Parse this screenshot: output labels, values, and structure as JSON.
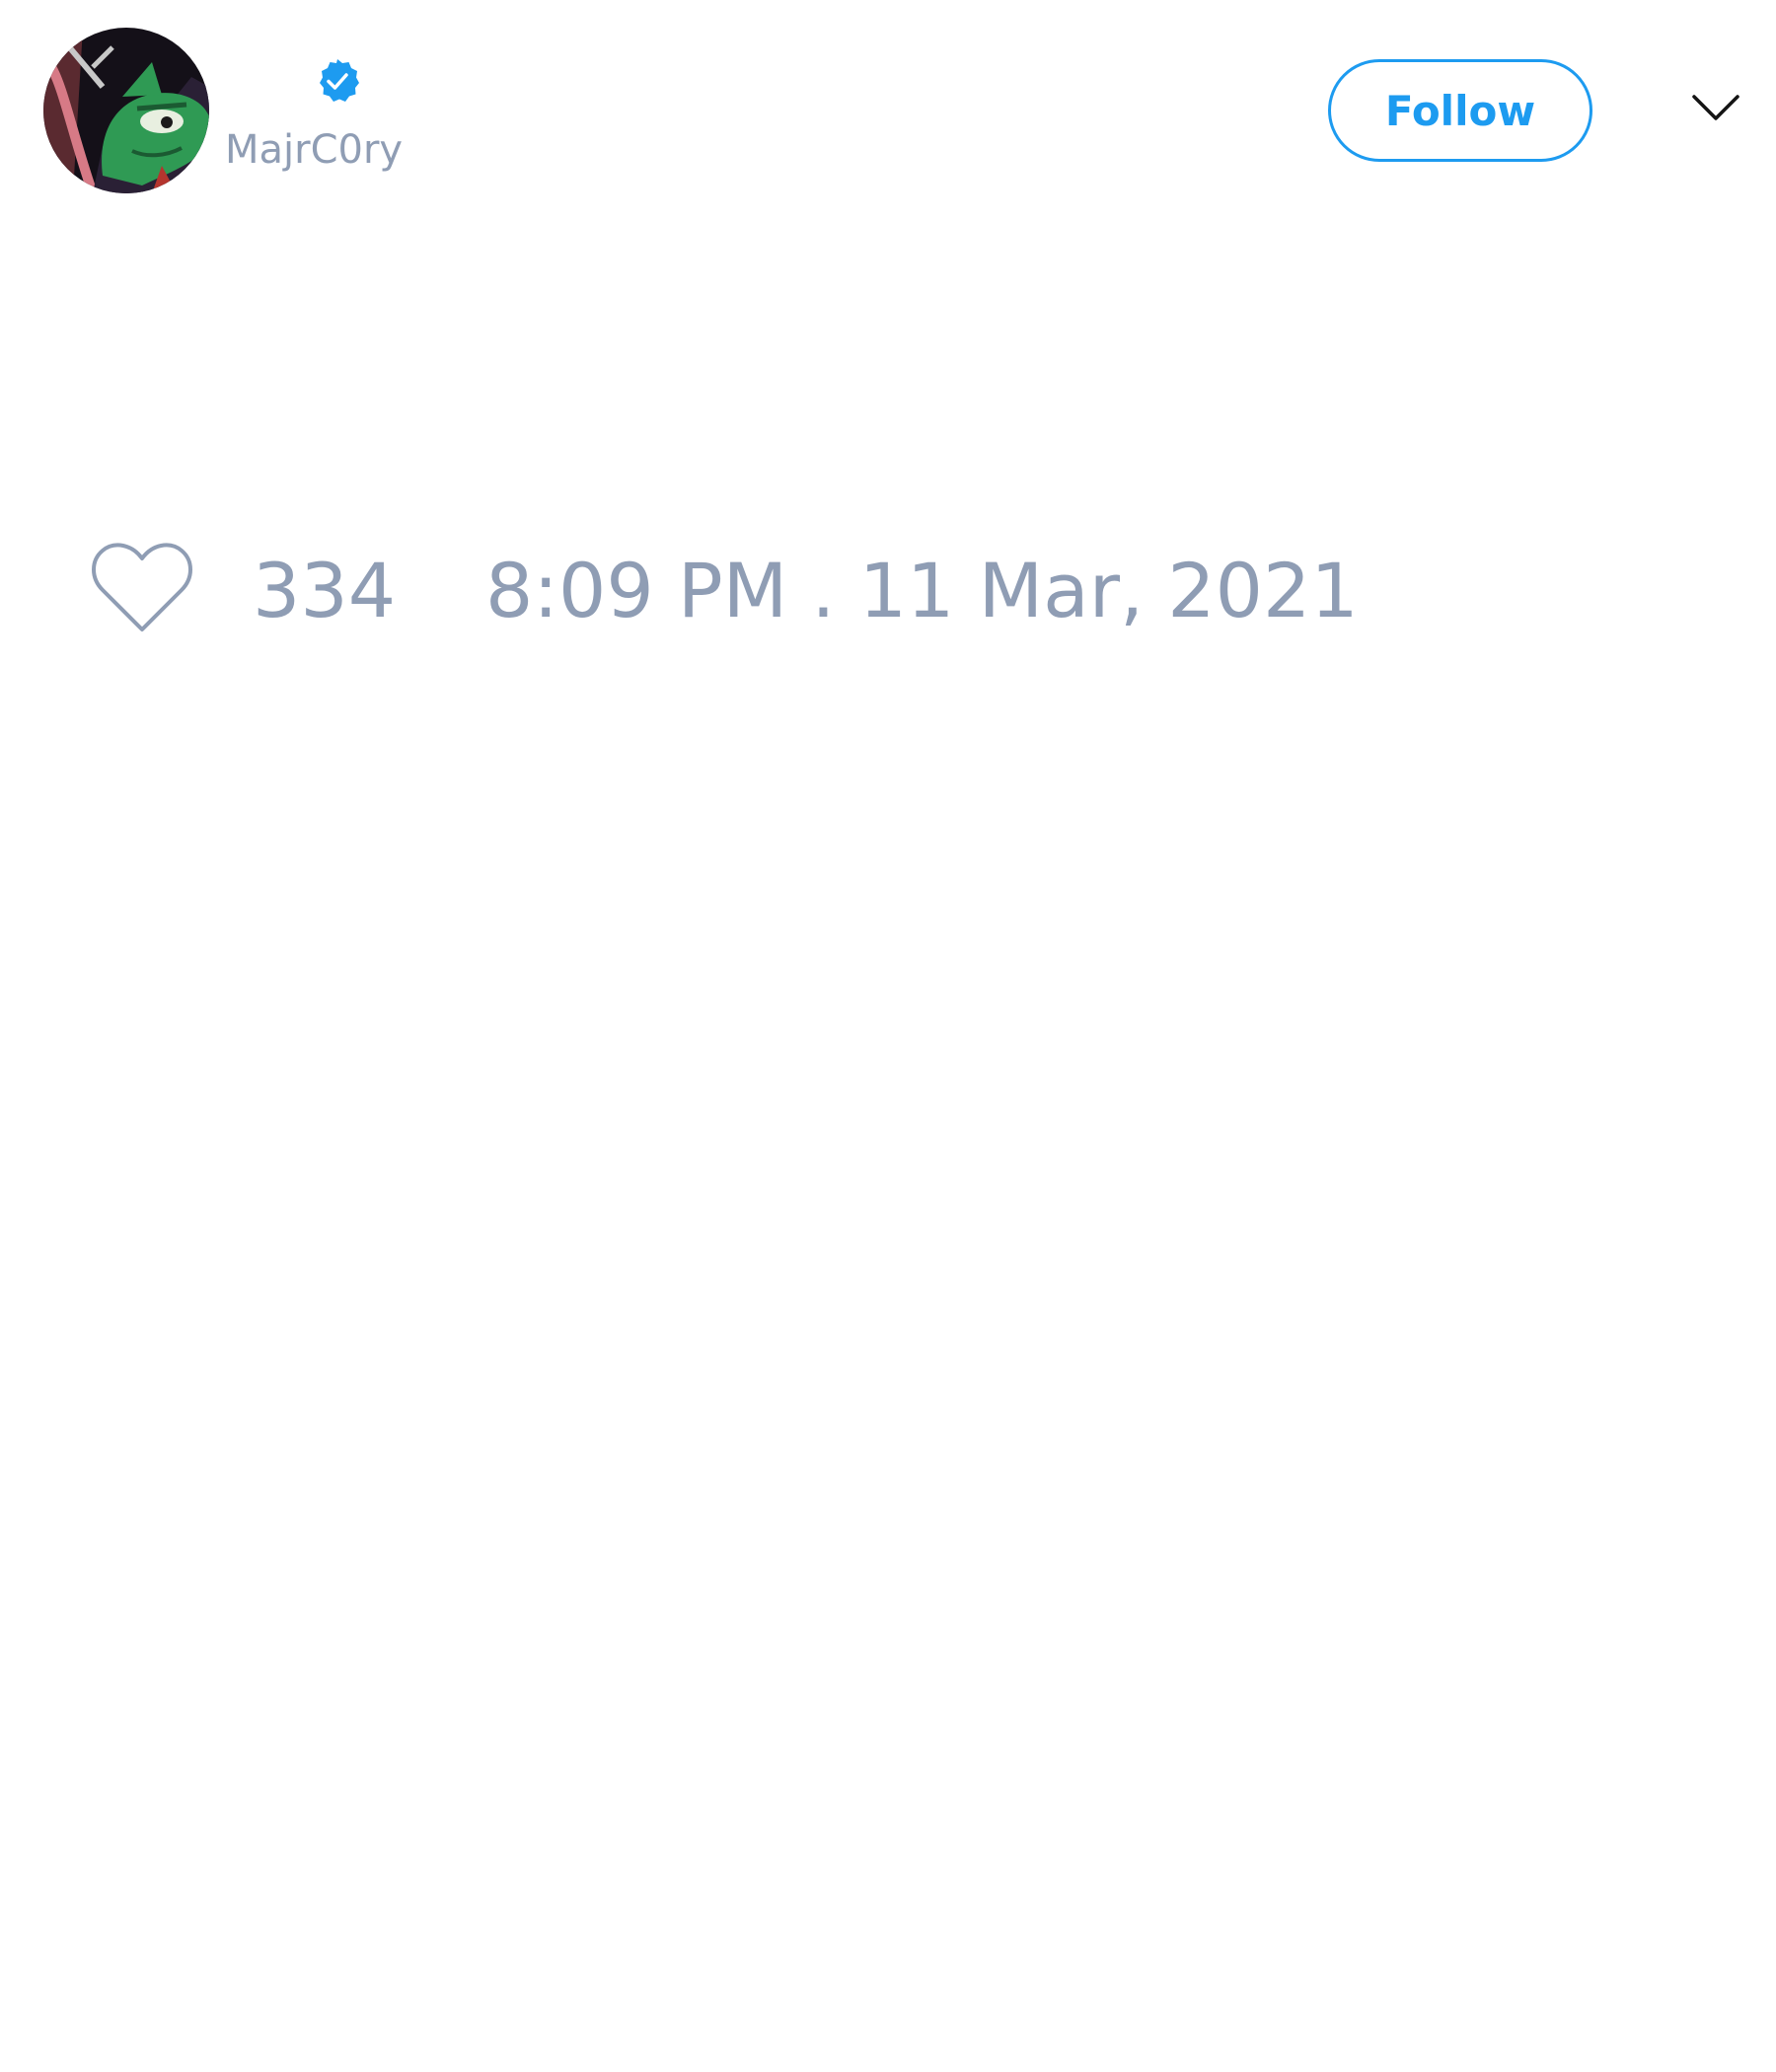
{
  "tweet": {
    "author": {
      "handle": "MajrC0ry",
      "verified": true,
      "avatar_icon": "avatar-cartoon-green-character"
    },
    "follow_label": "Follow",
    "menu_icon": "chevron-down-icon",
    "like_icon": "heart-icon",
    "likes": "334",
    "timestamp": "8:09 PM . 11 Mar, 2021"
  },
  "colors": {
    "accent": "#1d9bf0",
    "muted_text": "#8f9db4",
    "background": "#ffffff"
  }
}
